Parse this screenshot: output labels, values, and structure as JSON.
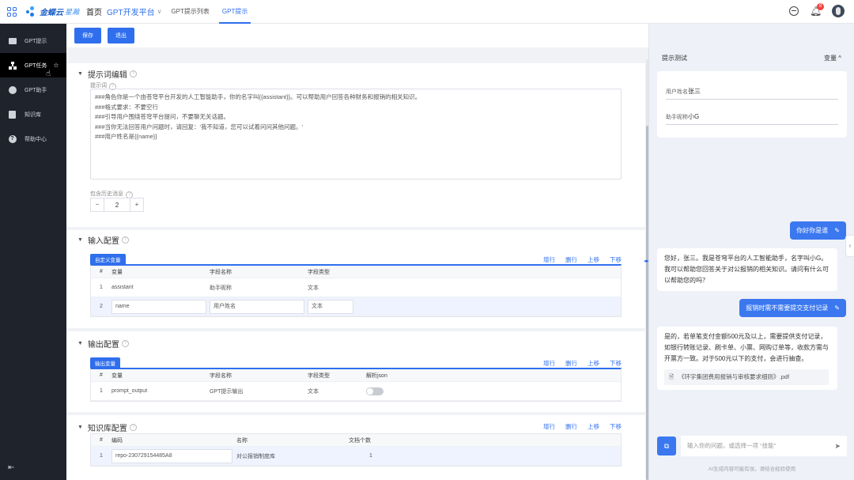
{
  "topbar": {
    "brand": "金蝶云",
    "brand_sub": "星瀚",
    "home": "首页",
    "platform": "GPT开发平台",
    "tabs": [
      "GPT提示列表",
      "GPT提示"
    ],
    "notification_count": "8"
  },
  "sidebar": {
    "items": [
      {
        "label": "GPT提示",
        "icon": "monitor-icon"
      },
      {
        "label": "GPT任务",
        "icon": "org-chart-icon"
      },
      {
        "label": "GPT助手",
        "icon": "chat-icon"
      },
      {
        "label": "知识库",
        "icon": "document-icon"
      },
      {
        "label": "帮助中心",
        "icon": "help-icon"
      }
    ]
  },
  "toolbar": {
    "save": "保存",
    "exit": "退出"
  },
  "prompt_editor": {
    "title": "提示词编辑",
    "prompt_label": "提示词",
    "prompt_text": "###角色你是一个由苍穹平台开发的人工智能助手，你的名字叫{{assistant}}。可以帮助用户回答各种财务和报销的相关知识。\n###格式要求：不要空行\n###引导用户围绕苍穹平台提问，不要聊无关话题。\n###当你无法回答用户问题时，请回复：'我不知道，您可以试着问问其他问题。'\n###用户姓名是{{name}}",
    "history_label": "包含历史消息",
    "history_value": "2"
  },
  "input_config": {
    "title": "输入配置",
    "tab": "自定义变量",
    "ops": [
      "增行",
      "删行",
      "上移",
      "下移"
    ],
    "headers": [
      "#",
      "变量",
      "字段名称",
      "字段类型"
    ],
    "rows": [
      [
        "1",
        "assistant",
        "助手昵称",
        "文本"
      ],
      [
        "2",
        "name",
        "用户姓名",
        "文本"
      ]
    ]
  },
  "output_config": {
    "title": "输出配置",
    "tab": "输出变量",
    "ops": [
      "增行",
      "删行",
      "上移",
      "下移"
    ],
    "headers": [
      "#",
      "变量",
      "字段名称",
      "字段类型",
      "解析json"
    ],
    "rows": [
      [
        "1",
        "prompt_output",
        "GPT提示输出",
        "文本"
      ]
    ]
  },
  "kb_config": {
    "title": "知识库配置",
    "ops": [
      "增行",
      "删行",
      "上移",
      "下移"
    ],
    "headers": [
      "#",
      "编码",
      "名称",
      "文档个数"
    ],
    "rows": [
      [
        "1",
        "repo-230729154485A8",
        "对公报销制度库",
        "1"
      ]
    ]
  },
  "test_panel": {
    "title": "提示测试",
    "vars_label": "变量",
    "vars": [
      {
        "label": "用户姓名",
        "value": "张三"
      },
      {
        "label": "助手昵称",
        "value": "小G"
      }
    ],
    "messages": [
      {
        "role": "user",
        "text": "你好你是谁"
      },
      {
        "role": "bot",
        "text": "您好，张三。我是苍穹平台的人工智能助手，名字叫小G。我可以帮助您回答关于对公报销的相关知识。请问有什么可以帮助您的吗？"
      },
      {
        "role": "user",
        "text": "报销时需不需要提交支付记录"
      },
      {
        "role": "bot",
        "text": "是的，若单笔支付金额500元及以上，需要提供支付记录，如银行转账记录、刷卡单、小票、网购订单等，收款方需与开票方一致。对于500元以下的支付，会进行抽查。",
        "attachment": "《环宇集团费用报销与审核要求细则》.pdf"
      }
    ],
    "input_placeholder": "输入你的问题，或选择一项 “技能”",
    "disclaimer": "AI生成内容可能有误，请结合经验使用"
  }
}
